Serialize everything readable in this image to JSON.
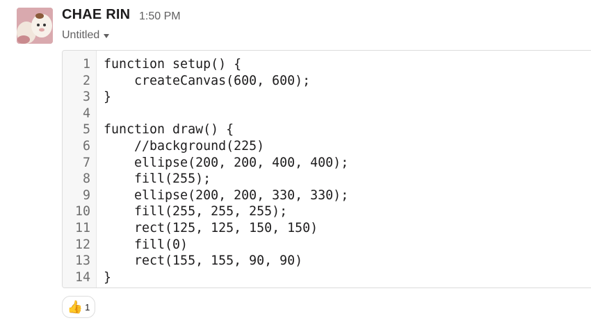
{
  "message": {
    "author": "CHAE RIN",
    "time": "1:50 PM",
    "file_title": "Untitled"
  },
  "snippet": {
    "lines": [
      {
        "n": "1",
        "code": "function setup() {"
      },
      {
        "n": "2",
        "code": "    createCanvas(600, 600);"
      },
      {
        "n": "3",
        "code": "}"
      },
      {
        "n": "4",
        "code": ""
      },
      {
        "n": "5",
        "code": "function draw() {"
      },
      {
        "n": "6",
        "code": "    //background(225)"
      },
      {
        "n": "7",
        "code": "    ellipse(200, 200, 400, 400);"
      },
      {
        "n": "8",
        "code": "    fill(255);"
      },
      {
        "n": "9",
        "code": "    ellipse(200, 200, 330, 330);"
      },
      {
        "n": "10",
        "code": "    fill(255, 255, 255);"
      },
      {
        "n": "11",
        "code": "    rect(125, 125, 150, 150)"
      },
      {
        "n": "12",
        "code": "    fill(0)"
      },
      {
        "n": "13",
        "code": "    rect(155, 155, 90, 90)"
      },
      {
        "n": "14",
        "code": "}"
      }
    ]
  },
  "reaction": {
    "emoji": "👍",
    "icon": "thumbs-up-icon",
    "count": "1"
  },
  "colors": {
    "text": "#1d1c1d",
    "muted": "#616061",
    "border": "#dcdcdc"
  }
}
